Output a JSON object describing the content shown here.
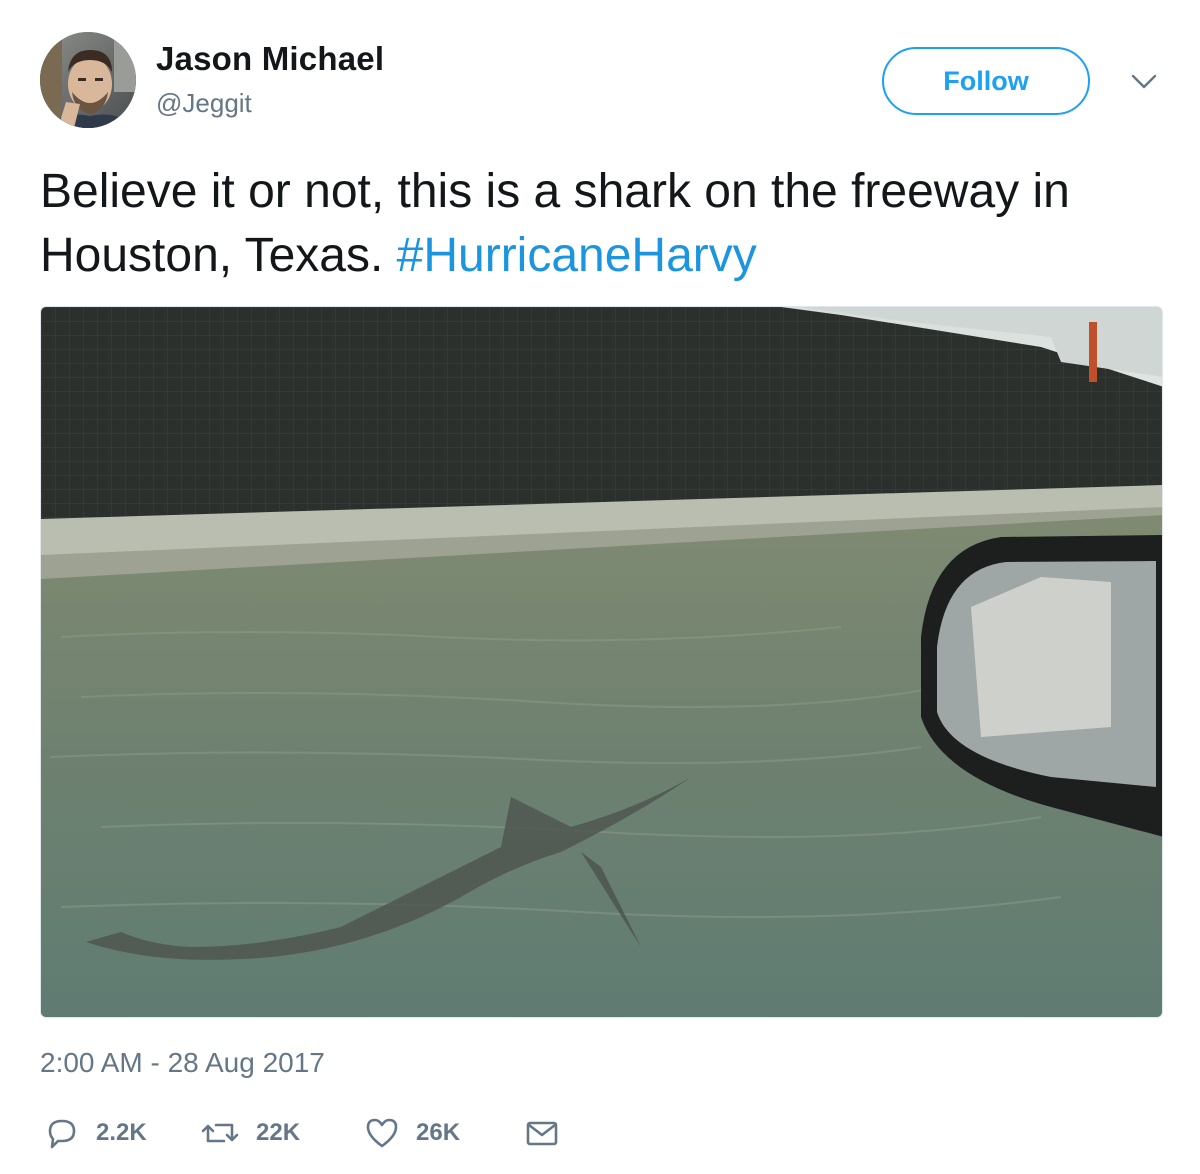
{
  "user": {
    "display_name": "Jason Michael",
    "handle": "@Jeggit",
    "avatar_icon": "avatar-photo"
  },
  "header": {
    "follow_label": "Follow",
    "menu_icon": "chevron-down-icon"
  },
  "tweet": {
    "text": "Believe it or not, this is a shark on the freeway in Houston, Texas. ",
    "hashtag": "#HurricaneHarvy",
    "media_description_icon": "photo",
    "timestamp": "2:00 AM - 28 Aug 2017"
  },
  "actions": {
    "reply_count": "2.2K",
    "retweet_count": "22K",
    "like_count": "26K"
  },
  "colors": {
    "accent": "#1da1f2",
    "hashtag": "#1b95e0",
    "muted": "#657786",
    "text": "#14171a"
  }
}
